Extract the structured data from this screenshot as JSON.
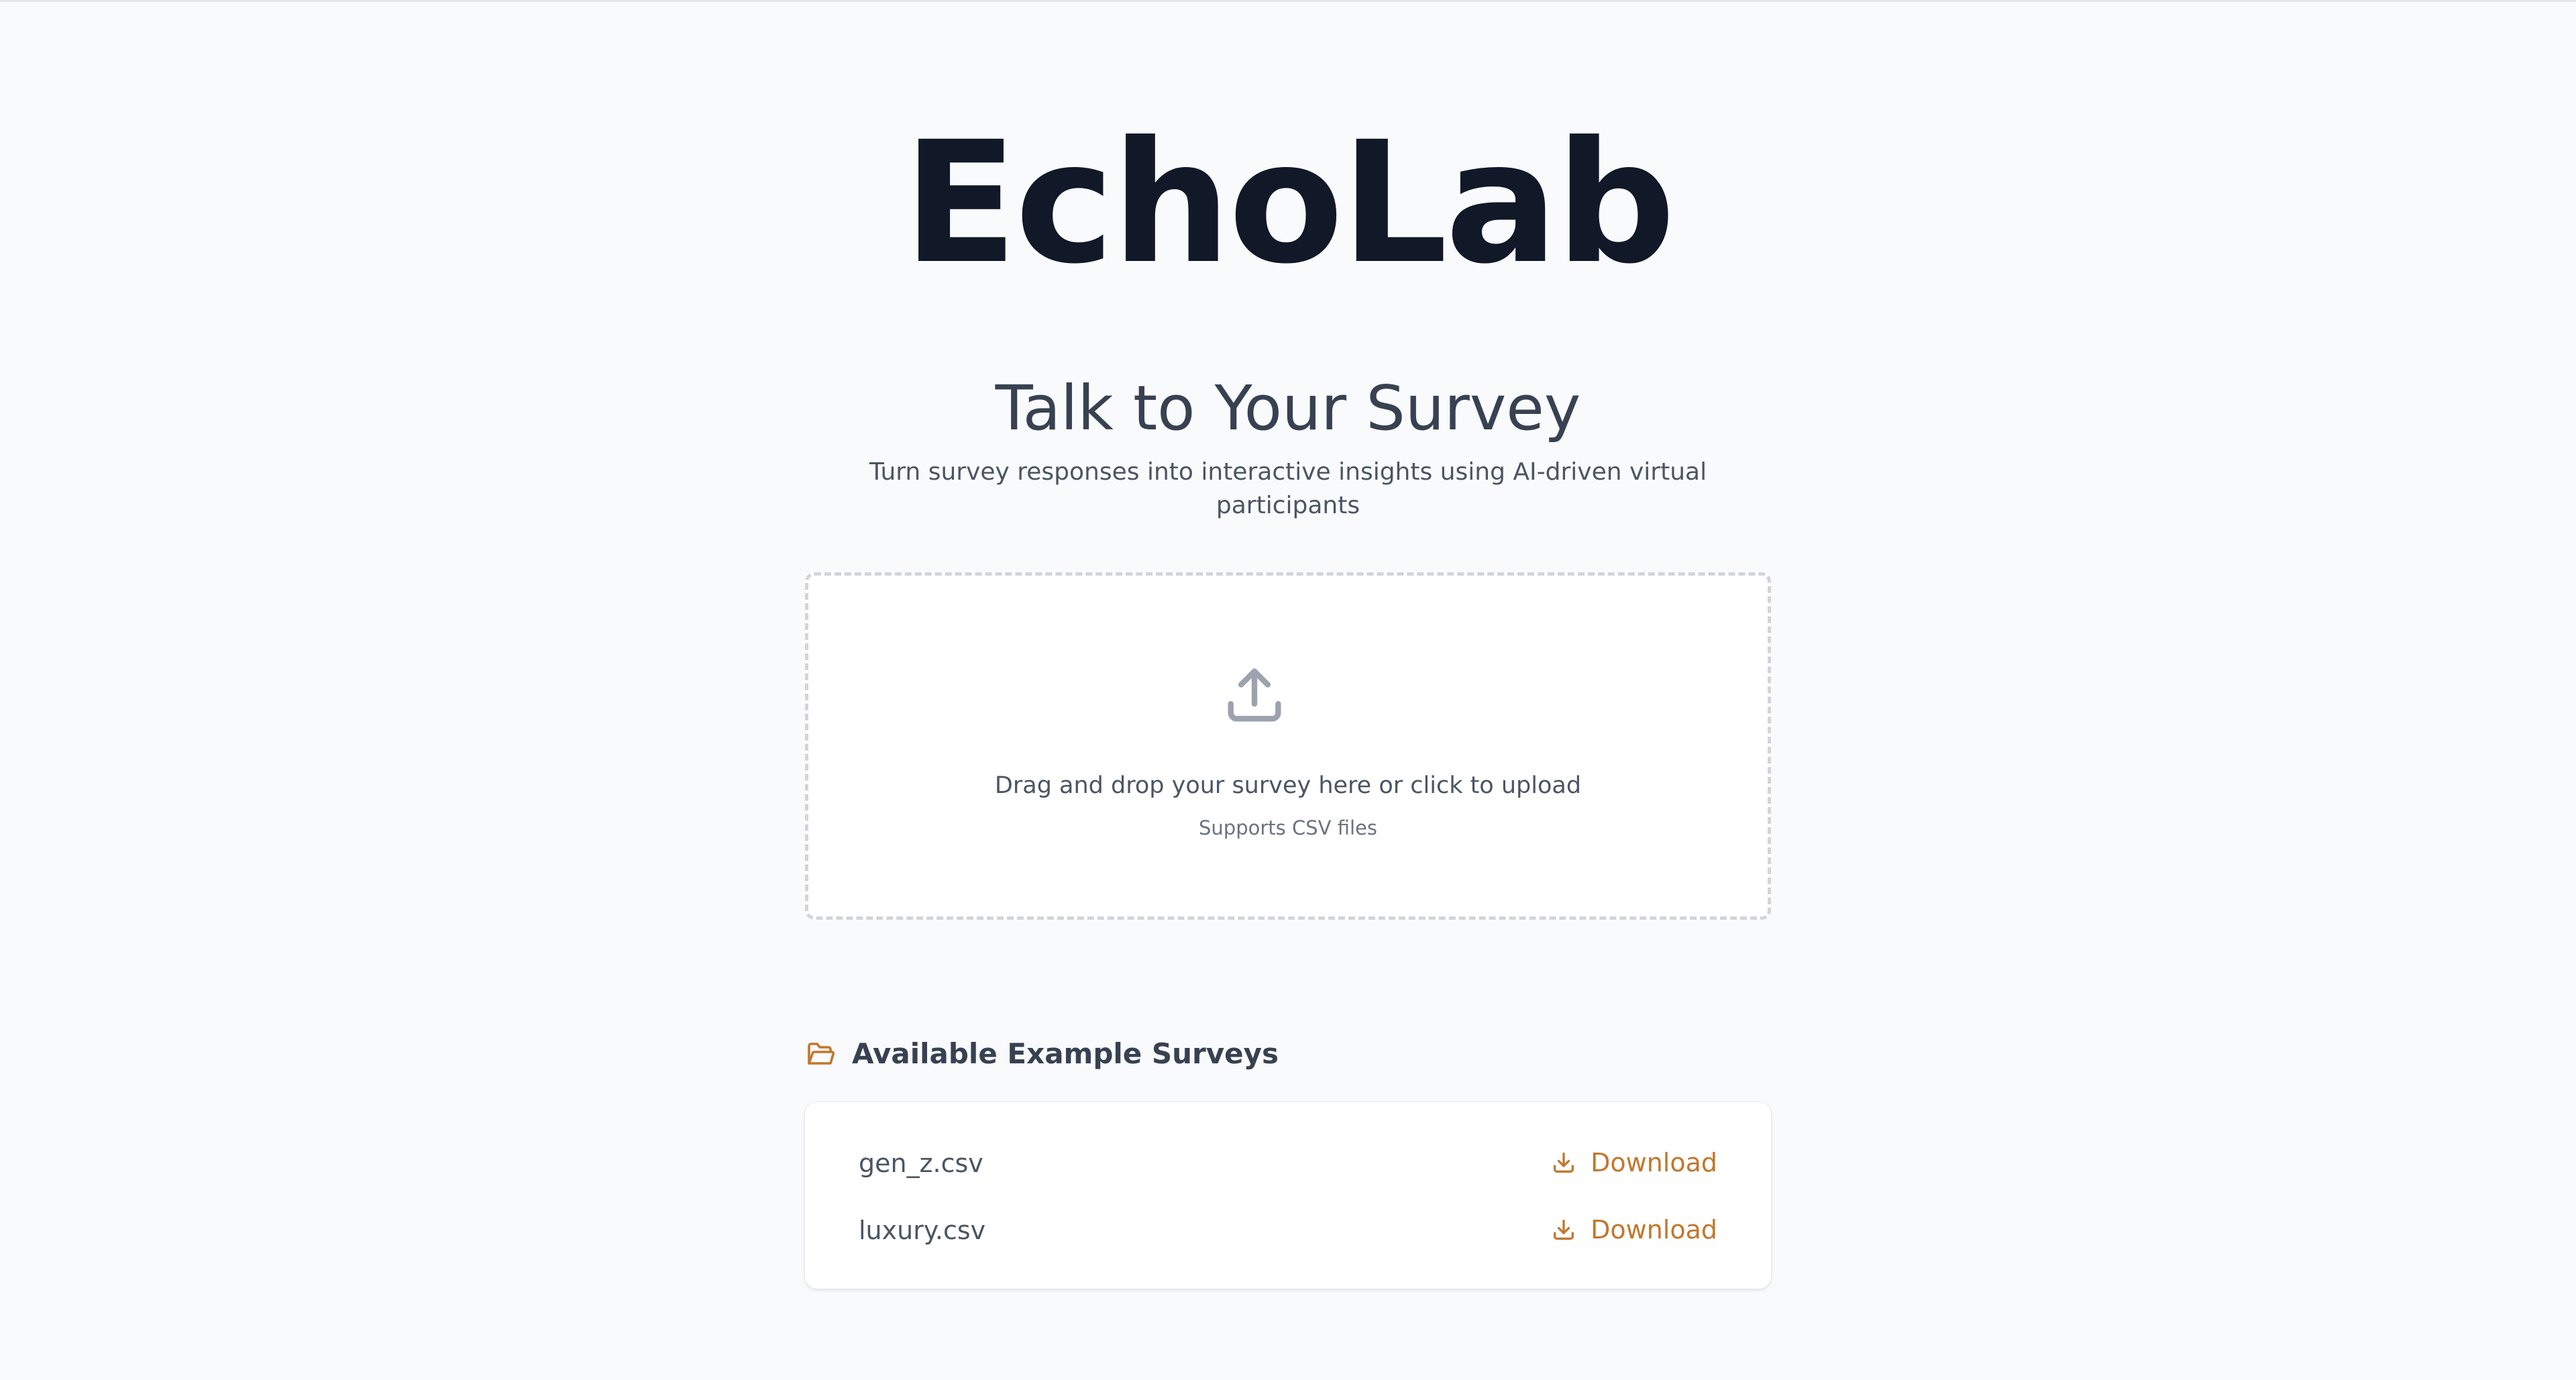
{
  "app": {
    "title": "EchoLab",
    "subtitle": "Talk to Your Survey",
    "tagline": "Turn survey responses into interactive insights using AI-driven virtual participants"
  },
  "upload": {
    "icon": "upload-icon",
    "prompt": "Drag and drop your survey here or click to upload",
    "supports": "Supports CSV files"
  },
  "examples": {
    "icon": "folder-open-icon",
    "title": "Available Example Surveys",
    "items": [
      {
        "file": "gen_z.csv",
        "action": "Download",
        "icon": "download-icon"
      },
      {
        "file": "luxury.csv",
        "action": "Download",
        "icon": "download-icon"
      }
    ]
  },
  "colors": {
    "background": "#f9fafb",
    "title": "#111827",
    "accent": "#c2772e",
    "dropzone_border": "#d1d5db",
    "icon_gray": "#9ca3af"
  }
}
